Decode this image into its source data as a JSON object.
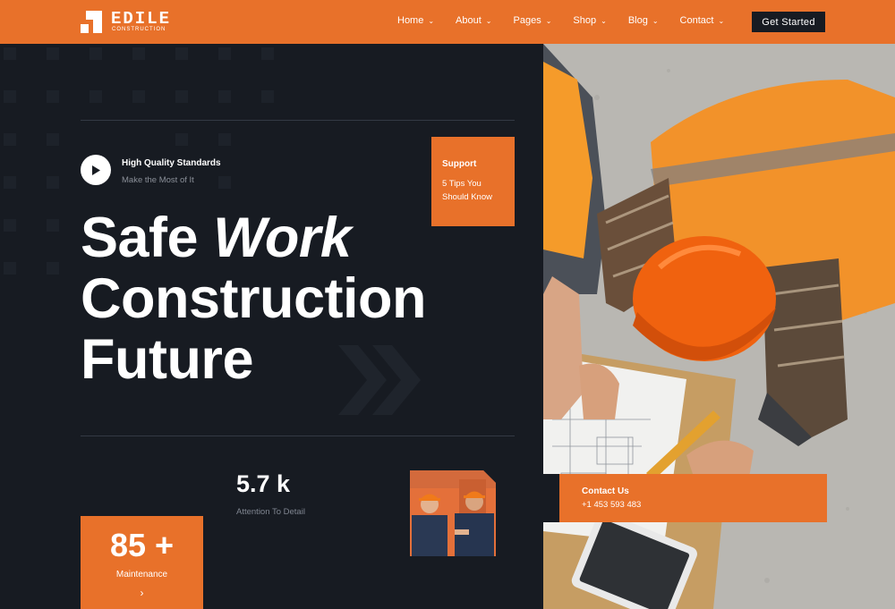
{
  "brand": {
    "name": "EDILE",
    "tagline": "CONSTRUCTION"
  },
  "nav": {
    "items": [
      {
        "label": "Home"
      },
      {
        "label": "About"
      },
      {
        "label": "Pages"
      },
      {
        "label": "Shop"
      },
      {
        "label": "Blog"
      },
      {
        "label": "Contact"
      }
    ],
    "cta_label": "Get Started"
  },
  "hero": {
    "video": {
      "title": "High Quality Standards",
      "subtitle": "Make the Most of It"
    },
    "support": {
      "title": "Support",
      "text": "5 Tips You Should Know"
    },
    "headline": {
      "line1_plain": "Safe ",
      "line1_italic": "Work",
      "line2": "Construction",
      "line3": "Future"
    }
  },
  "stats": {
    "attention": {
      "value": "5.7 k",
      "label": "Attention To Detail"
    },
    "maintenance": {
      "value": "85 +",
      "label": "Maintenance"
    }
  },
  "contact": {
    "title": "Contact Us",
    "phone": "+1 453 593 483"
  },
  "colors": {
    "accent": "#e8712a",
    "dark": "#171b22"
  }
}
